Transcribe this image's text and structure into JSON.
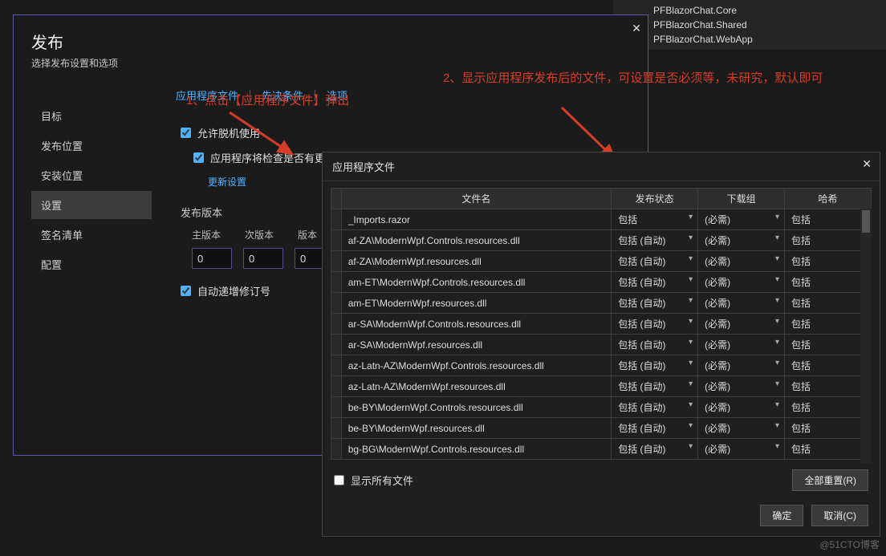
{
  "solution": {
    "items": [
      "PFBlazorChat.Core",
      "PFBlazorChat.Shared",
      "PFBlazorChat.WebApp"
    ]
  },
  "dialog": {
    "title": "发布",
    "subtitle": "选择发布设置和选项",
    "close": "✕",
    "sidebar": [
      "目标",
      "发布位置",
      "安装位置",
      "设置",
      "签名清单",
      "配置"
    ],
    "selected_index": 3,
    "links": {
      "app_files": "应用程序文件",
      "prereq": "先决条件",
      "options": "选项"
    },
    "offline": "允许脱机使用",
    "app_check": "应用程序将检查是否有更",
    "update_settings": "更新设置",
    "version_label": "发布版本",
    "ver_cols": [
      "主版本",
      "次版本",
      "版本"
    ],
    "ver_vals": [
      "0",
      "0",
      "0"
    ],
    "auto_inc": "自动递增修订号"
  },
  "annot": {
    "a1": "1、点击【应用程序文件】弹出",
    "a2": "2、显示应用程序发布后的文件，可设置是否必须等，未研究，默认即可"
  },
  "inner": {
    "title": "应用程序文件",
    "close": "✕",
    "headers": {
      "file": "文件名",
      "state": "发布状态",
      "dl": "下载组",
      "hash": "哈希"
    },
    "show_all": "显示所有文件",
    "reset": "全部重置(R)",
    "ok": "确定",
    "cancel": "取消(C)",
    "rows": [
      {
        "file": "_Imports.razor",
        "state": "包括",
        "dl": "(必需)",
        "hash": "包括"
      },
      {
        "file": "af-ZA\\ModernWpf.Controls.resources.dll",
        "state": "包括 (自动)",
        "dl": "(必需)",
        "hash": "包括"
      },
      {
        "file": "af-ZA\\ModernWpf.resources.dll",
        "state": "包括 (自动)",
        "dl": "(必需)",
        "hash": "包括"
      },
      {
        "file": "am-ET\\ModernWpf.Controls.resources.dll",
        "state": "包括 (自动)",
        "dl": "(必需)",
        "hash": "包括"
      },
      {
        "file": "am-ET\\ModernWpf.resources.dll",
        "state": "包括 (自动)",
        "dl": "(必需)",
        "hash": "包括"
      },
      {
        "file": "ar-SA\\ModernWpf.Controls.resources.dll",
        "state": "包括 (自动)",
        "dl": "(必需)",
        "hash": "包括"
      },
      {
        "file": "ar-SA\\ModernWpf.resources.dll",
        "state": "包括 (自动)",
        "dl": "(必需)",
        "hash": "包括"
      },
      {
        "file": "az-Latn-AZ\\ModernWpf.Controls.resources.dll",
        "state": "包括 (自动)",
        "dl": "(必需)",
        "hash": "包括"
      },
      {
        "file": "az-Latn-AZ\\ModernWpf.resources.dll",
        "state": "包括 (自动)",
        "dl": "(必需)",
        "hash": "包括"
      },
      {
        "file": "be-BY\\ModernWpf.Controls.resources.dll",
        "state": "包括 (自动)",
        "dl": "(必需)",
        "hash": "包括"
      },
      {
        "file": "be-BY\\ModernWpf.resources.dll",
        "state": "包括 (自动)",
        "dl": "(必需)",
        "hash": "包括"
      },
      {
        "file": "bg-BG\\ModernWpf.Controls.resources.dll",
        "state": "包括 (自动)",
        "dl": "(必需)",
        "hash": "包括"
      }
    ]
  },
  "watermark": "@51CTO博客"
}
